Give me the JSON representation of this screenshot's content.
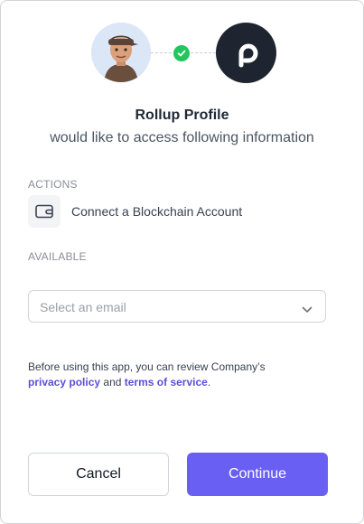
{
  "header": {
    "app_name": "Rollup Profile",
    "subtitle": "would like to access following information"
  },
  "icons": {
    "user_avatar": "user-avatar",
    "connection_status": "checkmark-icon",
    "app_logo": "rollup-logo",
    "action_icon": "wallet-icon",
    "dropdown_chevron": "chevron-down-icon"
  },
  "actions": {
    "label": "ACTIONS",
    "items": [
      {
        "label": "Connect a Blockchain Account"
      }
    ]
  },
  "available": {
    "label": "AVAILABLE",
    "email_select": {
      "placeholder": "Select an email"
    }
  },
  "privacy": {
    "prefix": "Before using this app, you can review Company’s",
    "privacy_link": "privacy policy",
    "and": "and",
    "terms_link": "terms of service",
    "suffix": "."
  },
  "buttons": {
    "cancel": "Cancel",
    "continue": "Continue"
  },
  "colors": {
    "accent": "#6a5ff3",
    "link": "#5a4fd6",
    "check": "#22c55e",
    "logo_bg": "#1e2530"
  }
}
